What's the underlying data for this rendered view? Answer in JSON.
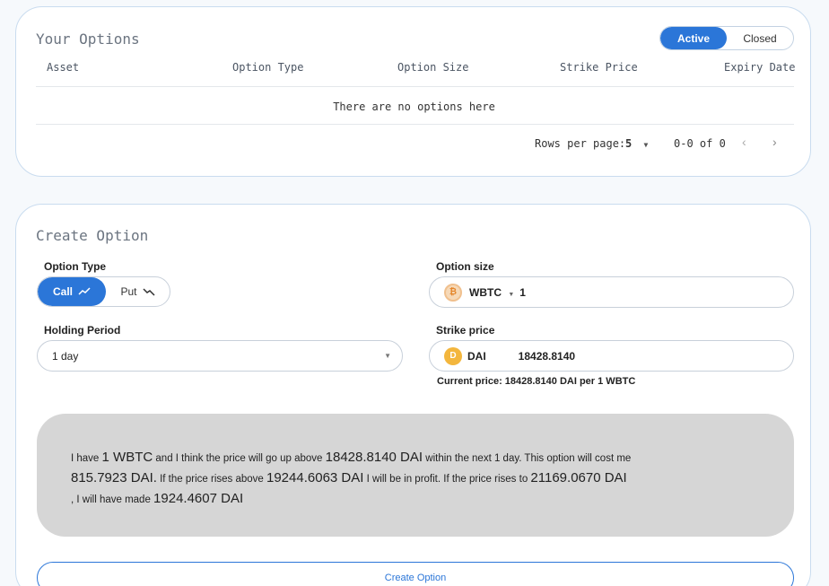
{
  "options": {
    "title": "Your Options",
    "toggle_active": "Active",
    "toggle_closed": "Closed",
    "columns": [
      "Asset",
      "Option Type",
      "Option Size",
      "Strike Price",
      "Expiry Date"
    ],
    "empty_text": "There are no options here",
    "rows_per_page_label": "Rows per page:",
    "rows_per_page_value": "5",
    "page_range": "0-0 of 0"
  },
  "create": {
    "title": "Create Option",
    "option_type_label": "Option Type",
    "call_label": "Call",
    "put_label": "Put",
    "holding_period_label": "Holding Period",
    "holding_period_value": "1 day",
    "option_size_label": "Option size",
    "asset": "WBTC",
    "size_value": "1",
    "strike_price_label": "Strike price",
    "strike_asset": "DAI",
    "strike_value": "18428.8140",
    "current_price": "Current price: 18428.8140 DAI per 1 WBTC",
    "summary": {
      "t1": "I have ",
      "v1": "1 WBTC",
      "t2": " and I think the price will go up above ",
      "v2": "18428.8140 DAI",
      "t3": " within the next 1 day. This option will cost me",
      "v3": "815.7923 DAI.",
      "t4": " If the price rises above ",
      "v4": "19244.6063 DAI",
      "t5": " I will be in profit. If the price rises to ",
      "v5": "21169.0670 DAI",
      "t6": ", I will have made ",
      "v6": "1924.4607 DAI"
    },
    "button_label": "Create Option"
  },
  "colors": {
    "accent": "#2b76d8",
    "card_border": "#c9dcef",
    "summary_bg": "#d6d6d6"
  }
}
